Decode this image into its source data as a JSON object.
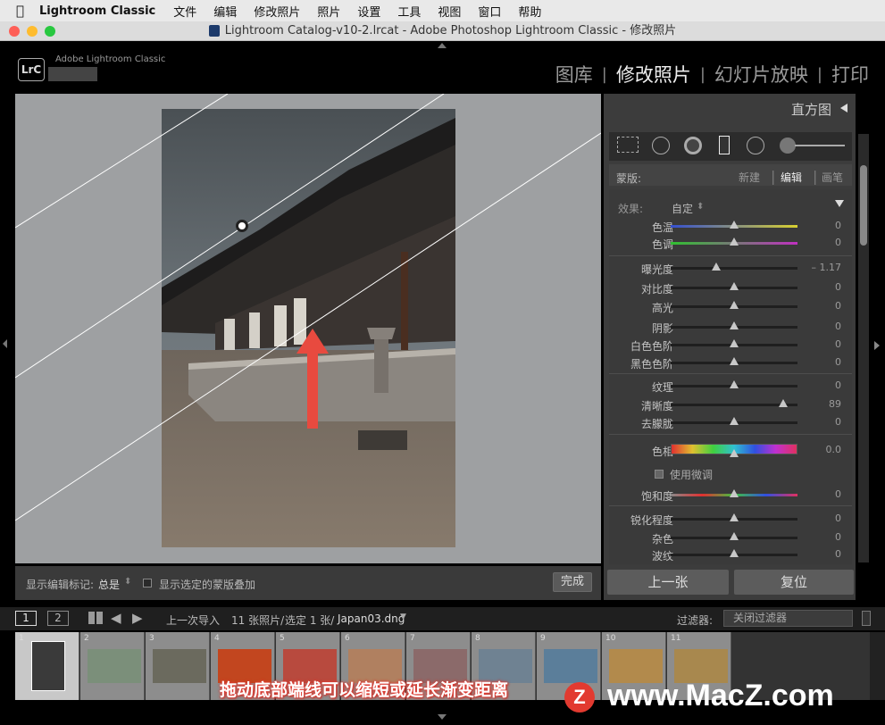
{
  "menubar": {
    "app": "Lightroom Classic",
    "items": [
      "文件",
      "编辑",
      "修改照片",
      "照片",
      "设置",
      "工具",
      "视图",
      "窗口",
      "帮助"
    ]
  },
  "window": {
    "title": "Lightroom Catalog-v10-2.lrcat - Adobe Photoshop Lightroom Classic - 修改照片"
  },
  "header": {
    "logo": "LrC",
    "product": "Adobe Lightroom Classic",
    "modules": [
      "图库",
      "修改照片",
      "幻灯片放映",
      "打印"
    ],
    "active_module": "修改照片"
  },
  "right_panel": {
    "histogram_label": "直方图",
    "mask": {
      "label": "蒙版:",
      "new": "新建",
      "edit": "编辑",
      "brush": "画笔"
    },
    "effect": {
      "label": "效果:",
      "value": "自定"
    },
    "sliders": [
      {
        "label": "色温",
        "value": "0",
        "pos": 0.5
      },
      {
        "label": "色调",
        "value": "0",
        "pos": 0.5
      },
      {
        "label": "曝光度",
        "value": "– 1.17",
        "pos": 0.36
      },
      {
        "label": "对比度",
        "value": "0",
        "pos": 0.5
      },
      {
        "label": "高光",
        "value": "0",
        "pos": 0.5
      },
      {
        "label": "阴影",
        "value": "0",
        "pos": 0.5
      },
      {
        "label": "白色色阶",
        "value": "0",
        "pos": 0.5
      },
      {
        "label": "黑色色阶",
        "value": "0",
        "pos": 0.5
      },
      {
        "label": "纹理",
        "value": "0",
        "pos": 0.5
      },
      {
        "label": "清晰度",
        "value": "89",
        "pos": 0.89
      },
      {
        "label": "去朦胧",
        "value": "0",
        "pos": 0.5
      },
      {
        "label": "色相",
        "value": "0.0",
        "pos": 0.5
      },
      {
        "label": "饱和度",
        "value": "0",
        "pos": 0.5
      },
      {
        "label": "锐化程度",
        "value": "0",
        "pos": 0.5
      },
      {
        "label": "杂色",
        "value": "0",
        "pos": 0.5
      },
      {
        "label": "波纹",
        "value": "0",
        "pos": 0.5
      }
    ],
    "fine_tune": "使用微调",
    "prev_button": "上一张",
    "reset_button": "复位"
  },
  "toolbar": {
    "show_edit_pins_label": "显示编辑标记:",
    "show_edit_pins_value": "总是",
    "show_overlay": "显示选定的蒙版叠加",
    "done": "完成"
  },
  "filmstrip_bar": {
    "page1": "1",
    "page2": "2",
    "source": "上一次导入",
    "count": "11 张照片/",
    "selected": "选定 1 张/",
    "filename": "Japan03.dng",
    "filter_label": "过滤器:",
    "filter_value": "关闭过滤器"
  },
  "filmstrip": {
    "thumbs": [
      {
        "num": "1",
        "color": "#3a3a3a"
      },
      {
        "num": "2",
        "color": "#7b8f7a"
      },
      {
        "num": "3",
        "color": "#6b6a5e"
      },
      {
        "num": "4",
        "color": "#c2461f"
      },
      {
        "num": "5",
        "color": "#b84a3e"
      },
      {
        "num": "6",
        "color": "#b08060"
      },
      {
        "num": "7",
        "color": "#8b6a6a"
      },
      {
        "num": "8",
        "color": "#6f8292"
      },
      {
        "num": "9",
        "color": "#5b7e9a"
      },
      {
        "num": "10",
        "color": "#b28a4c"
      },
      {
        "num": "11",
        "color": "#a8884e"
      }
    ]
  },
  "overlay": {
    "caption": "拖动底部端线可以缩短或延长渐变距离",
    "watermark": "www.MacZ.com",
    "watermark_badge": "Z"
  }
}
